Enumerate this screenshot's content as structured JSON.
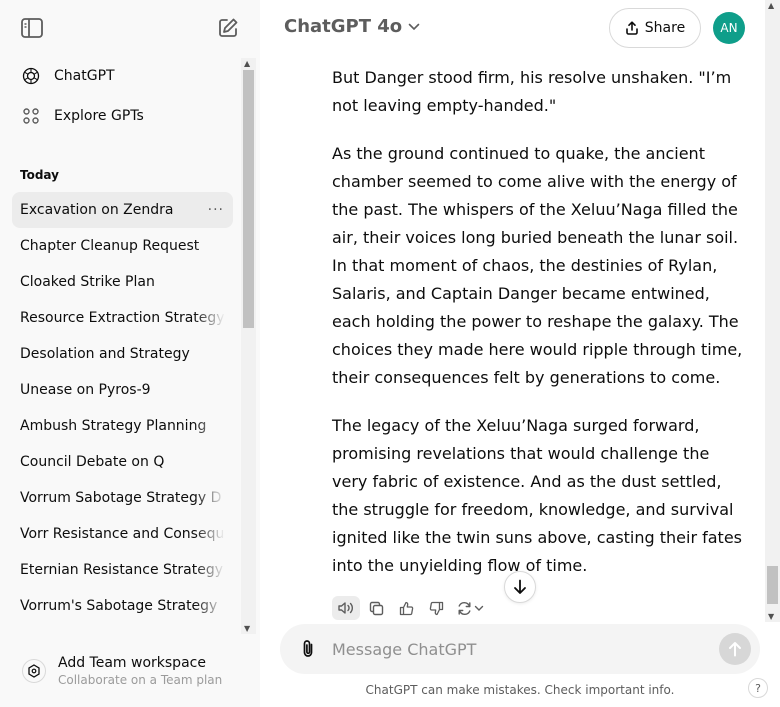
{
  "sidebar": {
    "nav": [
      {
        "label": "ChatGPT",
        "icon": "openai-logo-icon"
      },
      {
        "label": "Explore GPTs",
        "icon": "grid-icon"
      }
    ],
    "section_label": "Today",
    "history": [
      {
        "label": "Excavation on Zendra",
        "active": true
      },
      {
        "label": "Chapter Cleanup Request"
      },
      {
        "label": "Cloaked Strike Plan"
      },
      {
        "label": "Resource Extraction Strategy"
      },
      {
        "label": "Desolation and Strategy"
      },
      {
        "label": "Unease on Pyros-9"
      },
      {
        "label": "Ambush Strategy Planning"
      },
      {
        "label": "Council Debate on Q"
      },
      {
        "label": "Vorrum Sabotage Strategy D"
      },
      {
        "label": "Vorr Resistance and Consequ"
      },
      {
        "label": "Eternian Resistance Strategy"
      },
      {
        "label": "Vorrum's Sabotage Strategy"
      }
    ],
    "more_options": "···",
    "team": {
      "title": "Add Team workspace",
      "subtitle": "Collaborate on a Team plan"
    }
  },
  "header": {
    "model": "ChatGPT 4o",
    "share_label": "Share",
    "avatar_initials": "AN",
    "avatar_color": "#0f9e8a"
  },
  "message": {
    "paragraphs": [
      "But Danger stood firm, his resolve unshaken. \"I’m not leaving empty-handed.\"",
      "As the ground continued to quake, the ancient chamber seemed to come alive with the energy of the past. The whispers of the Xeluu’Naga filled the air, their voices long buried beneath the lunar soil. In that moment of chaos, the destinies of Rylan, Salaris, and Captain Danger became entwined, each holding the power to reshape the galaxy. The choices they made here would ripple through time, their consequences felt by generations to come.",
      "The legacy of the Xeluu’Naga surged forward, promising revelations that would challenge the very fabric of existence. And as the dust settled, the struggle for freedom, knowledge, and survival ignited like the twin suns above, casting their fates into the unyielding flow of time."
    ]
  },
  "composer": {
    "placeholder": "Message ChatGPT"
  },
  "footer": {
    "disclaimer": "ChatGPT can make mistakes. Check important info.",
    "help": "?"
  }
}
